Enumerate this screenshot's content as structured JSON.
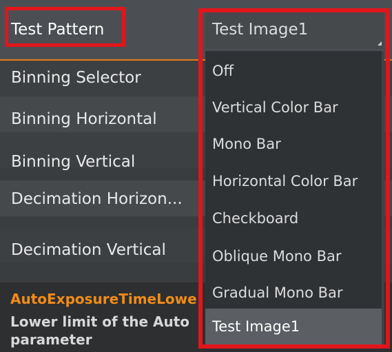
{
  "header": {
    "label": "Test Pattern",
    "value": "Test Image1"
  },
  "properties": [
    {
      "label": "Binning Selector"
    },
    {
      "label": "Binning Horizontal"
    },
    {
      "label": "Binning Vertical"
    },
    {
      "label": "Decimation Horizon..."
    },
    {
      "label": "Decimation Vertical"
    }
  ],
  "description": {
    "title": "AutoExposureTimeLowe",
    "text": "Lower limit of the Auto parameter"
  },
  "dropdown": {
    "options": [
      {
        "label": "Off"
      },
      {
        "label": "Vertical Color Bar"
      },
      {
        "label": "Mono Bar"
      },
      {
        "label": "Horizontal Color Bar"
      },
      {
        "label": "Checkboard"
      },
      {
        "label": "Oblique Mono Bar"
      },
      {
        "label": "Gradual Mono Bar"
      },
      {
        "label": "Test Image1"
      }
    ],
    "selected": "Test Image1"
  },
  "colors": {
    "highlight": "#e1151b",
    "accent": "#f08c18",
    "background": "#3a3d40"
  }
}
